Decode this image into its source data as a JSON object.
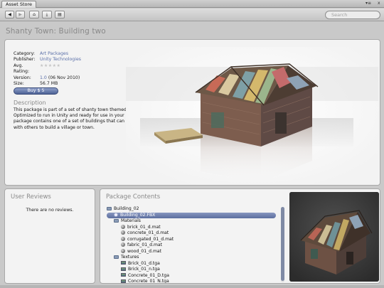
{
  "window": {
    "tab_label": "Asset Store",
    "menu_glyph": "▾≡",
    "close_glyph": "x"
  },
  "toolbar": {
    "back_glyph": "◀",
    "forward_glyph": "▶",
    "home_glyph": "⌂",
    "download_glyph": "⤓",
    "list_glyph": "▤",
    "search_placeholder": "Search"
  },
  "package": {
    "title": "Shanty Town: Building two",
    "category_label": "Category:",
    "category": "Art Packages",
    "publisher_label": "Publisher:",
    "publisher": "Unity Technologies",
    "rating_label": "Avg. Rating:",
    "rating_stars": "★★★★★",
    "rating_value": 0,
    "version_label": "Version:",
    "version_number": "1.0",
    "version_date": "(06 Nov 2010)",
    "size_label": "Size:",
    "size": "56.7 MB",
    "buy_label": "Buy $ 5",
    "description_heading": "Description",
    "description": "This package is part of a set of shanty town themed art assets, Optimized to run in Unity and ready for use in your projects. This package contains one of a set of buildings that can be used alone or with others to build a village or town."
  },
  "reviews": {
    "heading": "User Reviews",
    "empty_text": "There are no reviews."
  },
  "contents": {
    "heading": "Package Contents",
    "items": [
      {
        "label": "Building_02",
        "kind": "folder",
        "depth": 0
      },
      {
        "label": "Building_02.FBX",
        "kind": "fbx",
        "depth": 1,
        "selected": true
      },
      {
        "label": "Materials",
        "kind": "folder",
        "depth": 1
      },
      {
        "label": "brick_01_d.mat",
        "kind": "mat",
        "depth": 2
      },
      {
        "label": "concrete_01_d.mat",
        "kind": "mat",
        "depth": 2
      },
      {
        "label": "corrugated_01_d.mat",
        "kind": "mat",
        "depth": 2
      },
      {
        "label": "fabric_01_d.mat",
        "kind": "mat",
        "depth": 2
      },
      {
        "label": "wood_01_d.mat",
        "kind": "mat",
        "depth": 2
      },
      {
        "label": "Textures",
        "kind": "folder",
        "depth": 1
      },
      {
        "label": "Brick_01_d.tga",
        "kind": "tex",
        "depth": 2
      },
      {
        "label": "Brick_01_n.tga",
        "kind": "tex",
        "depth": 2
      },
      {
        "label": "Concrete_01_D.tga",
        "kind": "tex",
        "depth": 2
      },
      {
        "label": "Concrete_01_N.tga",
        "kind": "tex",
        "depth": 2
      }
    ]
  },
  "colors": {
    "accent": "#5c6f9f",
    "link": "#5a6fa8",
    "panel_bg": "#f3f3f3",
    "window_bg": "#c9c9c9"
  }
}
